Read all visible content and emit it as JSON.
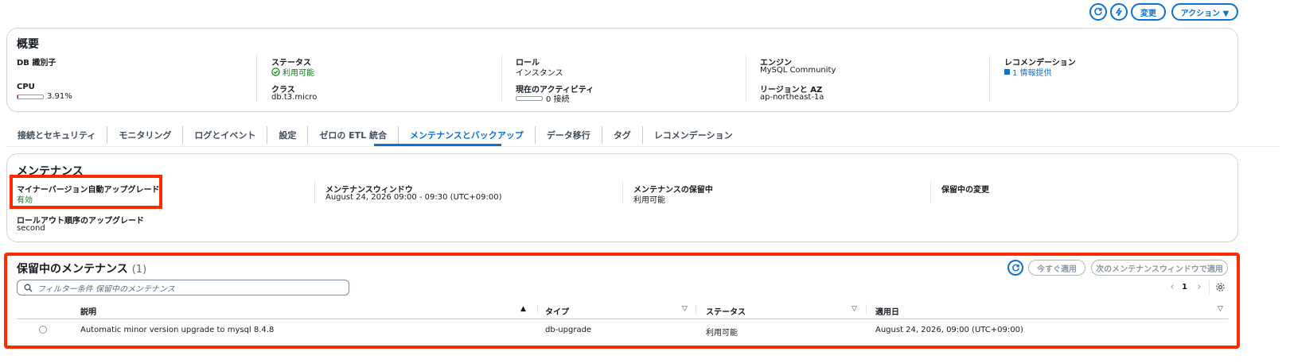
{
  "topbar": {
    "edit_label": "変更",
    "actions_label": "アクション ▼",
    "refresh_icon": "refresh-icon",
    "lightning_icon": "lightning-icon"
  },
  "overview": {
    "title": "概要",
    "db_identifier_label": "DB 識別子",
    "db_identifier_value": "",
    "cpu_label": "CPU",
    "cpu_value": "3.91%",
    "cpu_fraction": 0.0391,
    "status_label": "ステータス",
    "status_value": "利用可能",
    "class_label": "クラス",
    "class_value": "db.t3.micro",
    "role_label": "ロール",
    "role_value": "インスタンス",
    "activity_label": "現在のアクティビティ",
    "activity_value": "0 接続",
    "activity_fraction": 0.0,
    "engine_label": "エンジン",
    "engine_value": "MySQL Community",
    "region_label": "リージョンと AZ",
    "region_value": "ap-northeast-1a",
    "recommendation_label": "レコメンデーション",
    "recommendation_value": "1 情報提供"
  },
  "tabs": [
    {
      "label": "接続とセキュリティ"
    },
    {
      "label": "モニタリング"
    },
    {
      "label": "ログとイベント"
    },
    {
      "label": "設定"
    },
    {
      "label": "ゼロの ETL 統合"
    },
    {
      "label": "メンテナンスとバックアップ"
    },
    {
      "label": "データ移行"
    },
    {
      "label": "タグ"
    },
    {
      "label": "レコメンデーション"
    }
  ],
  "maintenance": {
    "title": "メンテナンス",
    "minor_upgrade_label": "マイナーバージョン自動アップグレード",
    "minor_upgrade_value": "有効",
    "window_label": "メンテナンスウィンドウ",
    "window_value": "August 24, 2026 09:00 - 09:30 (UTC+09:00)",
    "pending_label": "メンテナンスの保留中",
    "pending_value": "利用可能",
    "pending_changes_label": "保留中の変更",
    "rollout_label": "ロールアウト順序のアップグレード",
    "rollout_value": "second"
  },
  "pending": {
    "title": "保留中のメンテナンス",
    "count": "(1)",
    "apply_now": "今すぐ適用",
    "apply_next": "次のメンテナンスウィンドウで適用",
    "search_placeholder": "フィルター条件 保留中のメンテナンス",
    "page": "1",
    "columns": {
      "description": "説明",
      "type": "タイプ",
      "status": "ステータス",
      "apply_date": "適用日"
    },
    "rows": [
      {
        "description": "Automatic minor version upgrade to mysql 8.4.8",
        "type": "db-upgrade",
        "status": "利用可能",
        "apply_date": "August 24, 2026, 09:00 (UTC+09:00)"
      }
    ]
  },
  "colors": {
    "accent": "#0972d3",
    "success": "#037f0c",
    "highlight": "#ff2a00"
  }
}
